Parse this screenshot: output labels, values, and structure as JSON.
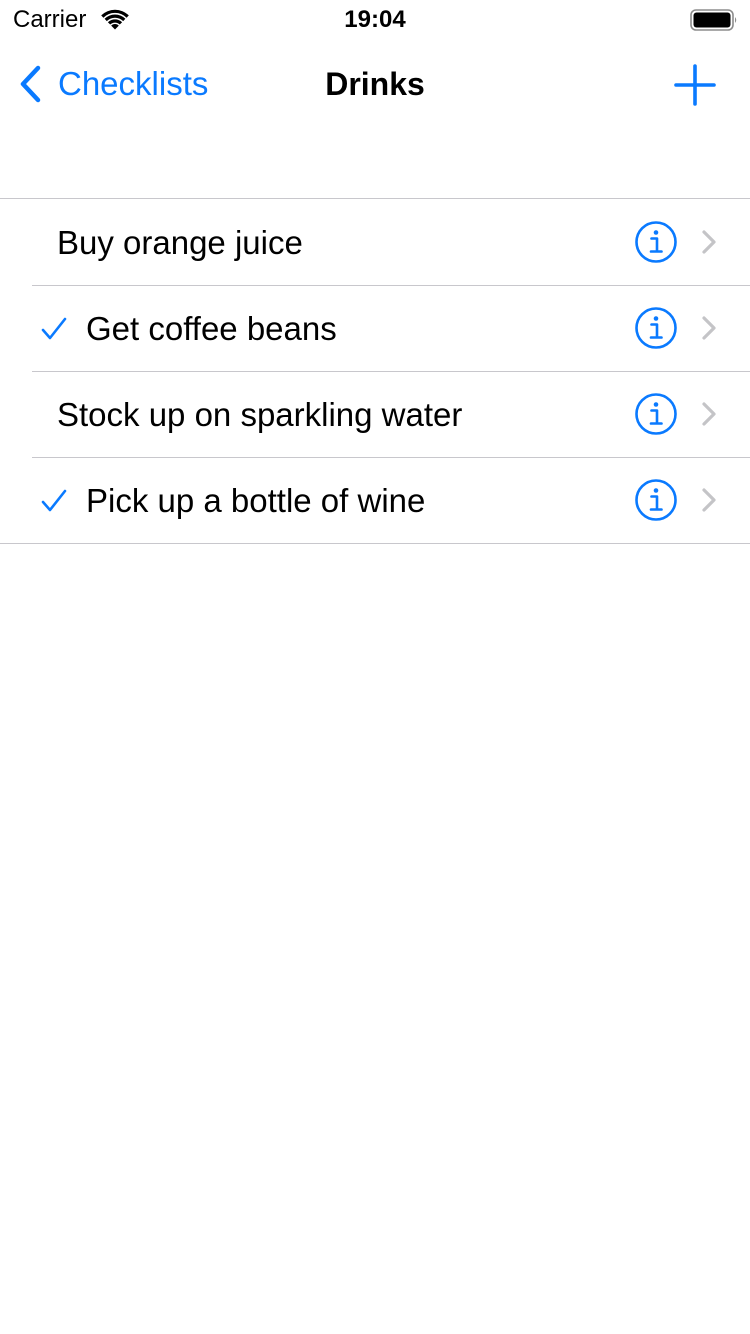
{
  "status_bar": {
    "carrier": "Carrier",
    "time": "19:04",
    "wifi_icon": "wifi-icon",
    "battery_icon": "battery-icon"
  },
  "nav": {
    "back_label": "Checklists",
    "back_icon": "chevron-left-icon",
    "title": "Drinks",
    "add_icon": "plus-icon"
  },
  "colors": {
    "accent": "#0a7aff",
    "separator": "#c8c7cc",
    "disclosure": "#c4c4c7"
  },
  "items": [
    {
      "label": "Buy orange juice",
      "checked": false
    },
    {
      "label": "Get coffee beans",
      "checked": true
    },
    {
      "label": "Stock up on sparkling water",
      "checked": false
    },
    {
      "label": "Pick up a bottle of wine",
      "checked": true
    }
  ]
}
